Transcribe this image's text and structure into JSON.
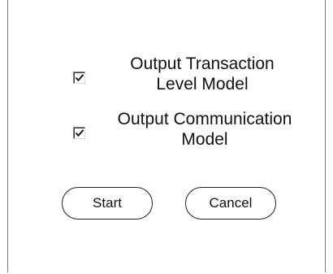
{
  "dialog": {
    "options": [
      {
        "label": "Output Transaction\nLevel Model",
        "checked": true
      },
      {
        "label": "Output Communication\nModel",
        "checked": true
      }
    ],
    "buttons": {
      "start_label": "Start",
      "cancel_label": "Cancel"
    },
    "colors": {
      "check_mark": "#1a1a1a",
      "border": "#222222"
    }
  }
}
